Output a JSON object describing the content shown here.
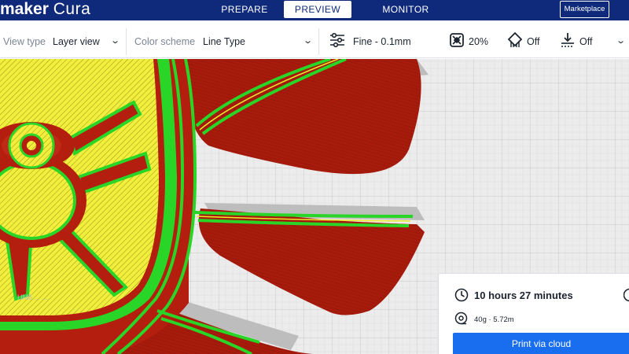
{
  "header": {
    "brand_bold": "maker",
    "brand_light": "Cura",
    "tabs": [
      {
        "label": "PREPARE",
        "active": false
      },
      {
        "label": "PREVIEW",
        "active": true
      },
      {
        "label": "MONITOR",
        "active": false
      }
    ],
    "marketplace_label": "Marketplace"
  },
  "toolbar": {
    "view_type_label": "View type",
    "view_type_value": "Layer view",
    "color_scheme_label": "Color scheme",
    "color_scheme_value": "Line Type",
    "profile": "Fine - 0.1mm",
    "infill": "20%",
    "support": "Off",
    "adhesion": "Off"
  },
  "print_panel": {
    "time": "10 hours 27 minutes",
    "material": "40g · 5.72m",
    "button_label": "Print via cloud"
  },
  "colors": {
    "header_bg": "#0f2a7a",
    "accent": "#196ef0",
    "wall_outer": "#b31e0e",
    "wall_inner": "#29d628",
    "skin": "#f2ee3c",
    "support": "#bfbfbf"
  }
}
